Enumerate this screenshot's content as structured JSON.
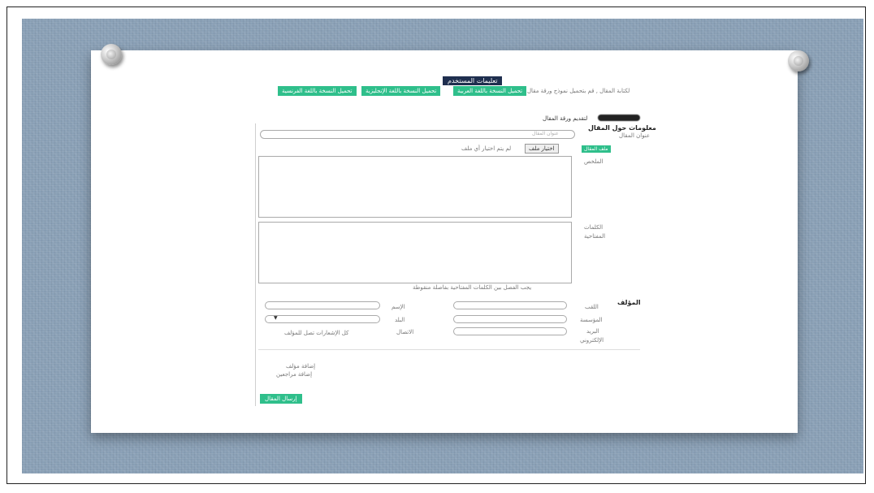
{
  "header": {
    "user_guide": "تعليمات المستخدم",
    "instruction": "لكتابة المقال , قم بتحميل نموذج ورقة مقال المجلة",
    "template_buttons": [
      "تحميل النسخة باللغة العربية",
      "تحميل النسخة باللغة الإنجليزية",
      "تحميل النسخة باللغة الفرنسية"
    ]
  },
  "form": {
    "submit_heading": "لتقديم ورقة المقال",
    "article_info_heading": "معلومات حول المقال",
    "title_label": "عنوان المقال",
    "title_placeholder": "عنوان المقال",
    "upload_badge": "ملف المقال",
    "choose_file_label": "اختيار ملف",
    "no_file_text": "لم يتم اختيار أي ملف",
    "abstract_label": "الملخص",
    "keywords_label_1": "الكلمات",
    "keywords_label_2": "المفتاحية",
    "keywords_hint": "يجب الفصل بين الكلمات المفتاحية بفاصلة منقوطة"
  },
  "authors": {
    "heading": "المؤلف",
    "lastname_label": "اللقب",
    "firstname_label": "الإسم",
    "institution_label": "المؤسسة",
    "country_label": "البلد",
    "email_label_1": "البريد",
    "email_label_2": "الإلكتروني",
    "contact_label": "الاتصال",
    "contact_note": "كل الإشعارات تصل للمؤلف",
    "add_author": "إضافة مؤلف",
    "add_reviewer": "إضافة مراجعين"
  },
  "submit_button": "إرسال المقال",
  "colors": {
    "accent_green": "#2fbf8b",
    "navy": "#1f2f4f",
    "board": "#8aa0b6"
  }
}
